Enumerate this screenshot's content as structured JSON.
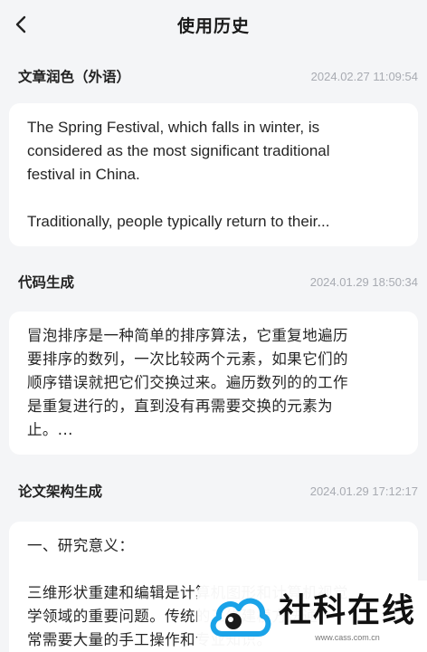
{
  "header": {
    "title": "使用历史",
    "back_icon": "chevron-left-icon"
  },
  "history": [
    {
      "type": "文章润色（外语）",
      "time": "2024.02.27 11:09:54",
      "lines": [
        "The Spring Festival, which falls in winter, is",
        "considered as the most significant traditional",
        "festival in China."
      ],
      "lines2": [
        "Traditionally, people typically return to their..."
      ]
    },
    {
      "type": "代码生成",
      "time": "2024.01.29 18:50:34",
      "lines": [
        "冒泡排序是一种简单的排序算法，它重复地遍历",
        "要排序的数列，一次比较两个元素，如果它们的",
        "顺序错误就把它们交换过来。遍历数列的的工作",
        "是重复进行的，直到没有再需要交换的元素为",
        "止。..."
      ]
    },
    {
      "type": "论文架构生成",
      "time": "2024.01.29 17:12:17",
      "lines": [
        "一、研究意义："
      ],
      "lines2": [
        "三维形状重建和编辑是计算机图形和计算机视觉",
        "学领域的重要问题。传统的三维建模方法通",
        "常需要大量的手工操作和专业知识。"
      ]
    }
  ],
  "watermark": {
    "text": "社科在线",
    "url": "www.cass.com.cn"
  },
  "colors": {
    "background": "#f4f5f7",
    "card": "#ffffff",
    "time": "#a8abb2",
    "logo_blue": "#1aa3e8"
  }
}
